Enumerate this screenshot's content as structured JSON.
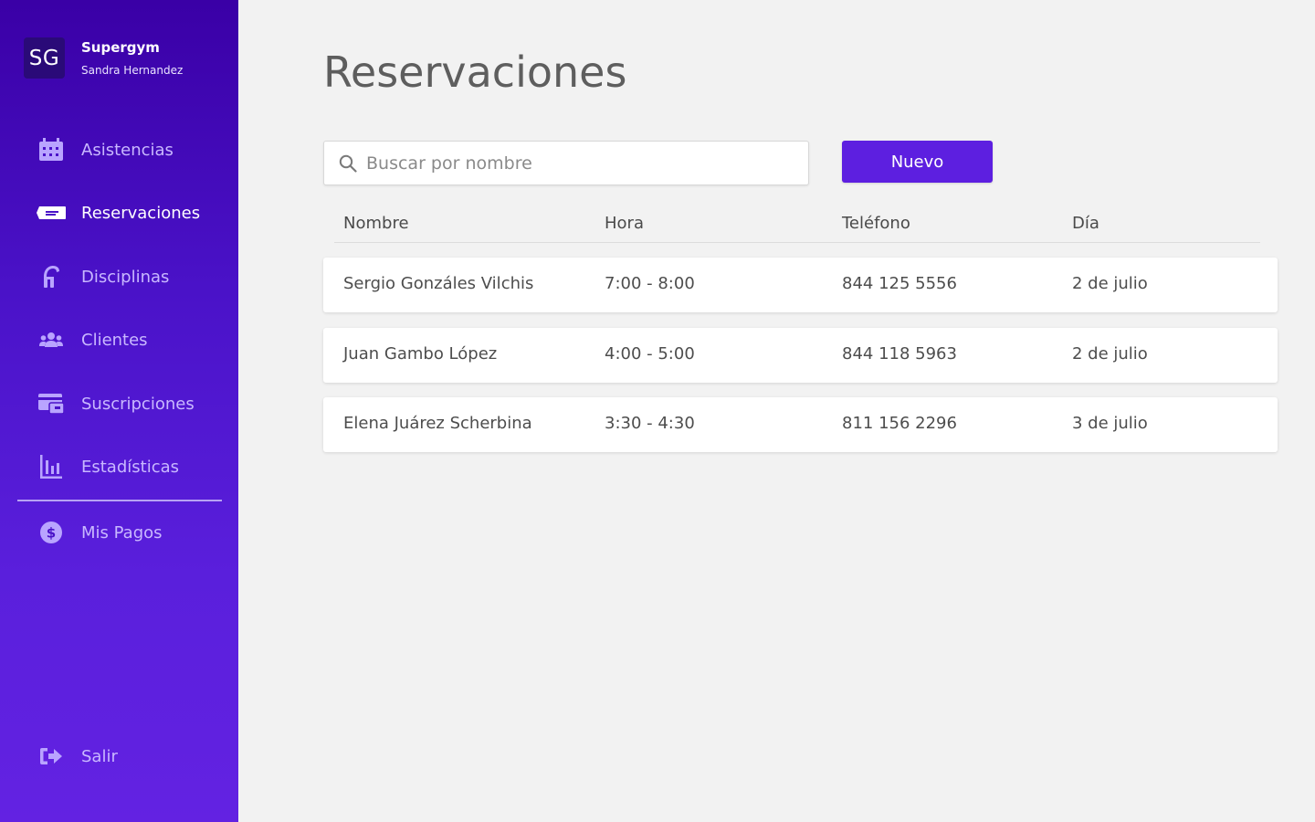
{
  "brand": {
    "logo_text": "SG",
    "name": "Supergym",
    "user": "Sandra Hernandez"
  },
  "sidebar": {
    "items": [
      {
        "label": "Asistencias",
        "icon": "calendar-icon"
      },
      {
        "label": "Reservaciones",
        "icon": "ticket-icon",
        "active": true
      },
      {
        "label": "Disciplinas",
        "icon": "yoga-icon"
      },
      {
        "label": "Clientes",
        "icon": "users-icon"
      },
      {
        "label": "Suscripciones",
        "icon": "card-icon"
      },
      {
        "label": "Estadísticas",
        "icon": "bar-chart-icon"
      },
      {
        "label": "Mis Pagos",
        "icon": "dollar-icon"
      }
    ],
    "logout_label": "Salir"
  },
  "main": {
    "title": "Reservaciones",
    "search_placeholder": "Buscar por nombre",
    "new_button": "Nuevo",
    "columns": [
      "Nombre",
      "Hora",
      "Teléfono",
      "Día"
    ],
    "rows": [
      {
        "nombre": "Sergio Gonzáles Vilchis",
        "hora": "7:00 - 8:00",
        "telefono": "844 125 5556",
        "dia": "2 de julio"
      },
      {
        "nombre": "Juan Gambo López",
        "hora": "4:00 - 5:00",
        "telefono": "844 118 5963",
        "dia": "2 de julio"
      },
      {
        "nombre": "Elena Juárez Scherbina",
        "hora": "3:30 - 4:30",
        "telefono": "811 156 2296",
        "dia": "3 de julio"
      }
    ]
  },
  "colors": {
    "sidebar_top": "#3a00a6",
    "sidebar_bottom": "#6322e2",
    "accent": "#5d1fe0",
    "background": "#f2f2f2"
  }
}
